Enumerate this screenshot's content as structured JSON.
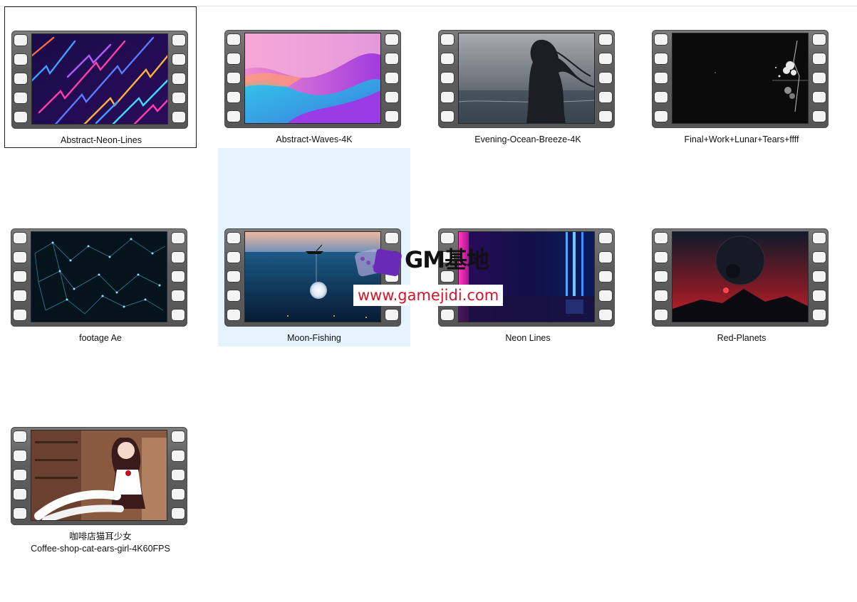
{
  "files": [
    {
      "name": "Abstract-Neon-Lines",
      "thumb": "neon-lines"
    },
    {
      "name": "Abstract-Waves-4K",
      "thumb": "waves"
    },
    {
      "name": "Evening-Ocean-Breeze-4K",
      "thumb": "ocean-girl"
    },
    {
      "name": "Final+Work+Lunar+Tears+ffff",
      "thumb": "dark-tree"
    },
    {
      "name": "footage Ae",
      "thumb": "network-mesh"
    },
    {
      "name": "Moon-Fishing",
      "thumb": "moon-fishing"
    },
    {
      "name": "Neon Lines",
      "thumb": "neon-bars"
    },
    {
      "name": "Red-Planets",
      "thumb": "red-planet"
    },
    {
      "name": "咖啡店猫耳少女",
      "name_line2": "Coffee-shop-cat-ears-girl-4K60FPS",
      "thumb": "cafe-girl"
    }
  ],
  "watermark": {
    "title": "GM基地",
    "url": "www.gamejidi.com",
    "icon": "dice-logo-icon"
  }
}
